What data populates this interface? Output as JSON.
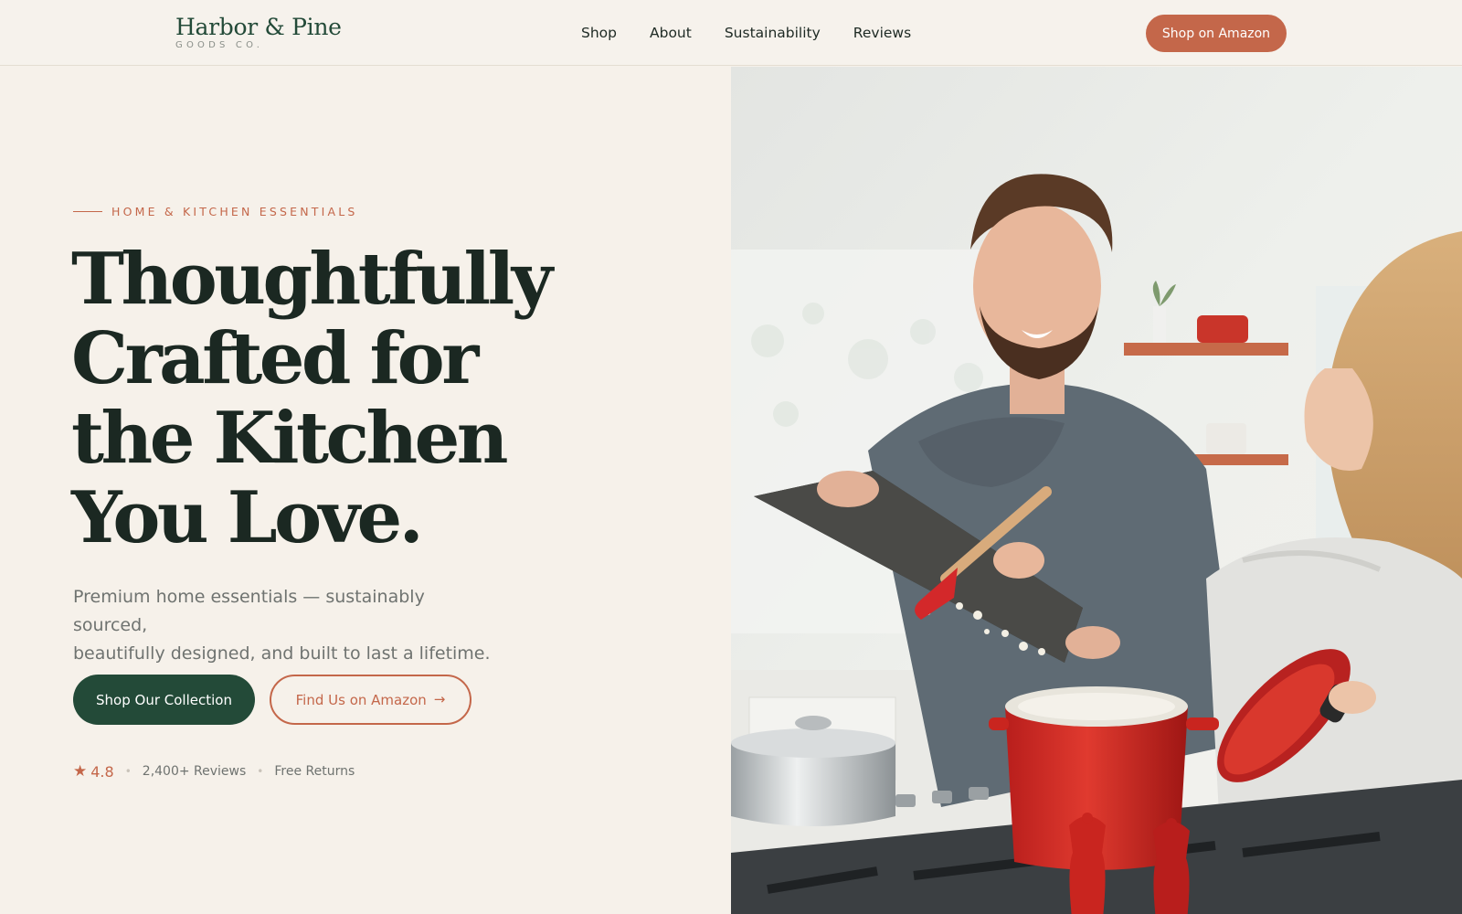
{
  "brand": {
    "name": "Harbor & Pine",
    "sub": "GOODS CO."
  },
  "nav": {
    "links": [
      "Shop",
      "About",
      "Sustainability",
      "Reviews"
    ],
    "cta": "Shop on Amazon"
  },
  "hero": {
    "eyebrow": "HOME & KITCHEN ESSENTIALS",
    "headline": [
      "Thoughtfully",
      "Crafted for",
      "the Kitchen",
      "You Love."
    ],
    "subtitle_lines": [
      "Premium home essentials — sustainably sourced,",
      "beautifully designed, and built to last a lifetime."
    ],
    "primary_cta": "Shop Our Collection",
    "secondary_cta": "Find Us on Amazon",
    "rating": "4.8",
    "reviews": "2,400+ Reviews",
    "returns": "Free Returns"
  },
  "colors": {
    "background": "#f6f1ea",
    "brand_green": "#234a38",
    "accent_terracotta": "#c4674a",
    "text_dark": "#1b2822"
  },
  "icons": {
    "arrow": "arrow-right-icon",
    "star": "star-icon"
  }
}
